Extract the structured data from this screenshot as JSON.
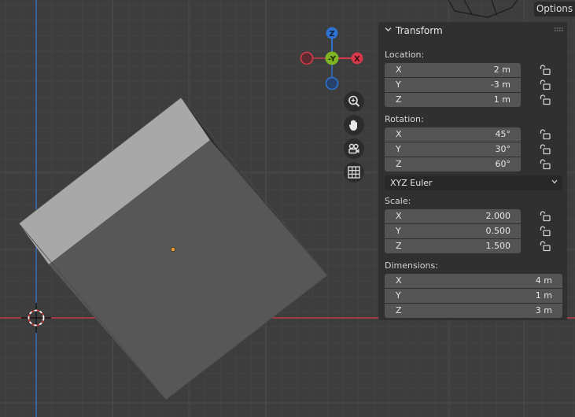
{
  "header": {
    "options_label": "Options"
  },
  "gizmo": {
    "z_label": "Z",
    "y_label": "-Y",
    "x_label": "X"
  },
  "panel": {
    "title": "Transform",
    "location": {
      "label": "Location:",
      "x": {
        "label": "X",
        "value": "2 m"
      },
      "y": {
        "label": "Y",
        "value": "-3 m"
      },
      "z": {
        "label": "Z",
        "value": "1 m"
      }
    },
    "rotation": {
      "label": "Rotation:",
      "x": {
        "label": "X",
        "value": "45°"
      },
      "y": {
        "label": "Y",
        "value": "30°"
      },
      "z": {
        "label": "Z",
        "value": "60°"
      }
    },
    "rotation_mode": "XYZ Euler",
    "scale": {
      "label": "Scale:",
      "x": {
        "label": "X",
        "value": "2.000"
      },
      "y": {
        "label": "Y",
        "value": "0.500"
      },
      "z": {
        "label": "Z",
        "value": "1.500"
      }
    },
    "dimensions": {
      "label": "Dimensions:",
      "x": {
        "label": "X",
        "value": "4 m"
      },
      "y": {
        "label": "Y",
        "value": "1 m"
      },
      "z": {
        "label": "Z",
        "value": "3 m"
      }
    }
  },
  "colors": {
    "background": "#3d3d3d",
    "x_axis": "#d2404d",
    "y_axis_line": "#3a6fc4",
    "gizmo_x": "#d63a4a",
    "gizmo_y": "#80b424",
    "gizmo_z": "#2f72d1",
    "origin_dot": "#f0a030",
    "panel_bg": "#303030",
    "field_bg": "#545454"
  },
  "icons": {
    "zoom": "zoom-icon",
    "pan": "hand-icon",
    "camera": "camera-icon",
    "grid": "grid-icon",
    "lock": "lock-icon",
    "cursor": "3d-cursor-icon"
  }
}
